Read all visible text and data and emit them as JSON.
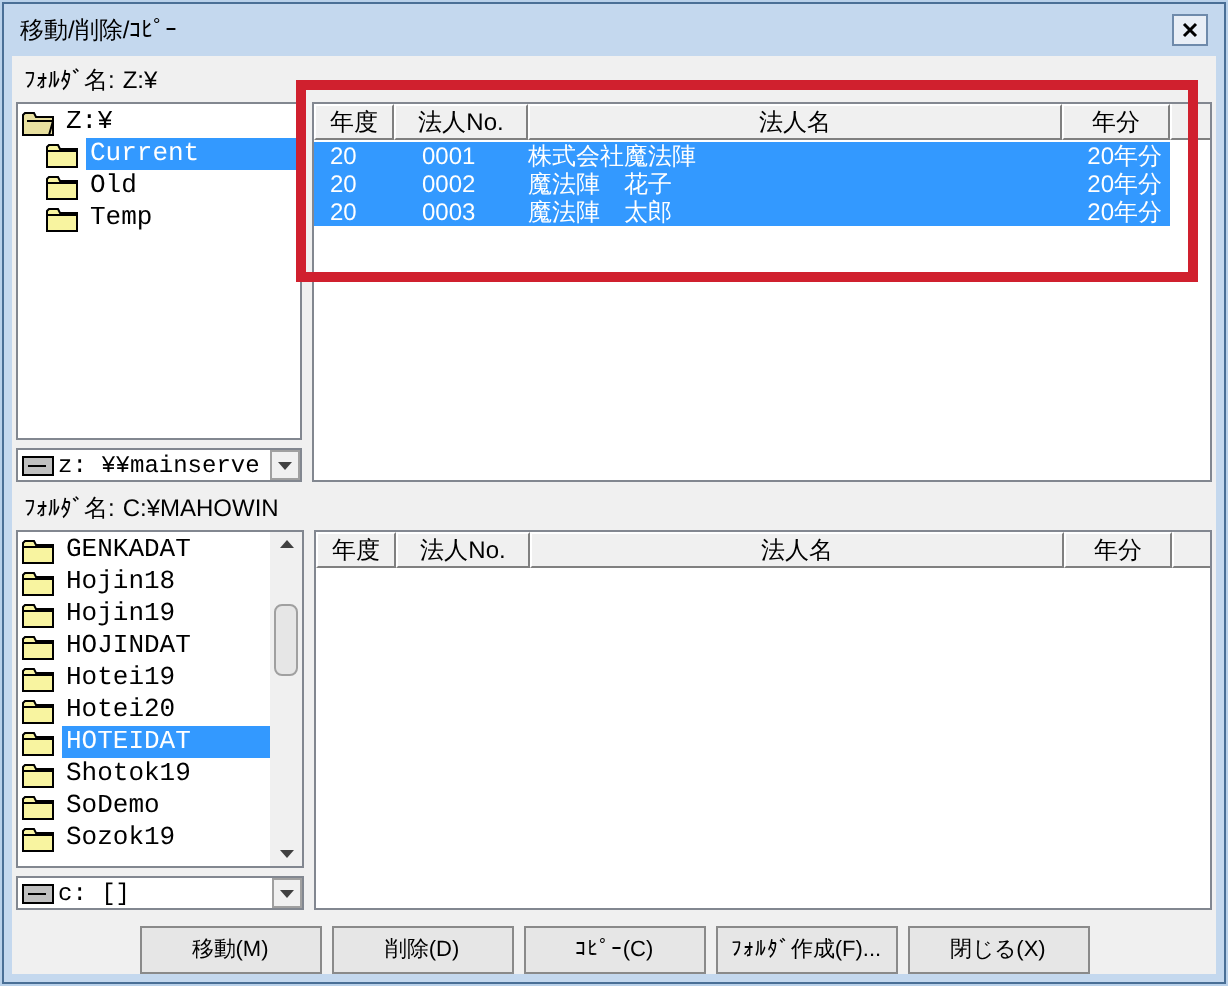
{
  "window": {
    "title": "移動/削除/ｺﾋﾟｰ"
  },
  "source": {
    "folder_label": "ﾌｫﾙﾀﾞ名:",
    "folder_path": "Z:¥",
    "tree": [
      {
        "label": "Z:¥",
        "expanded": true,
        "selected": false,
        "children": [
          {
            "label": "Current",
            "selected": true
          },
          {
            "label": "Old",
            "selected": false
          },
          {
            "label": "Temp",
            "selected": false
          }
        ]
      }
    ],
    "drive": "z: ¥¥mainserve",
    "table": {
      "columns": [
        "年度",
        "法人No.",
        "法人名",
        "年分"
      ],
      "rows": [
        {
          "cells": [
            "20",
            "0001",
            "株式会社魔法陣",
            "20年分"
          ],
          "selected": true
        },
        {
          "cells": [
            "20",
            "0002",
            "魔法陣　花子",
            "20年分"
          ],
          "selected": true
        },
        {
          "cells": [
            "20",
            "0003",
            "魔法陣　太郎",
            "20年分"
          ],
          "selected": true
        }
      ]
    }
  },
  "destination": {
    "folder_label": "ﾌｫﾙﾀﾞ名:",
    "folder_path": "C:¥MAHOWIN",
    "tree": [
      {
        "label": "GENKADAT",
        "selected": false
      },
      {
        "label": "Hojin18",
        "selected": false
      },
      {
        "label": "Hojin19",
        "selected": false
      },
      {
        "label": "HOJINDAT",
        "selected": false
      },
      {
        "label": "Hotei19",
        "selected": false
      },
      {
        "label": "Hotei20",
        "selected": false
      },
      {
        "label": "HOTEIDAT",
        "selected": true
      },
      {
        "label": "Shotok19",
        "selected": false
      },
      {
        "label": "SoDemo",
        "selected": false
      },
      {
        "label": "Sozok19",
        "selected": false
      }
    ],
    "drive": "c: []",
    "table": {
      "columns": [
        "年度",
        "法人No.",
        "法人名",
        "年分"
      ]
    }
  },
  "buttons": [
    "移動(M)",
    "削除(D)",
    "ｺﾋﾟｰ(C)",
    "ﾌｫﾙﾀﾞ作成(F)...",
    "閉じる(X)"
  ]
}
